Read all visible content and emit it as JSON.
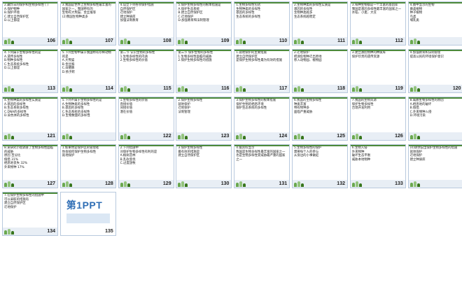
{
  "slides": [
    {
      "number": "106",
      "text": "2.藏羚羊的保护和生物多样性 (  )\nA.保护物种\nB.保护环境\nC.建立自然保护区\nD.以上都是"
    },
    {
      "number": "107",
      "text": "3.我国是世界上生物多样性最丰富的国家之一，我国特有的\n生物有大熊猫、金丝猴等\n(2)我国生物种类多"
    },
    {
      "number": "108",
      "text": "4.设立下列各项保护措施\n自然保护区\n迁地保护\n建立种质库\n加强法制教育"
    },
    {
      "number": "109",
      "text": "5.保护生物多样性的根本措施是\nA.保护生态系统\nB.建立自然保护区\nC.迁地保护\nD.加强教育和法制管理"
    },
    {
      "number": "110",
      "text": "1.生物多样性包括\n生物种类的多样性\n基因的多样性\n生态系统的多样性"
    },
    {
      "number": "111",
      "text": "2.生物种类的多样性实质是\n基因的多样性\n生物种类越多\n生态系统越稳定"
    },
    {
      "number": "112",
      "text": "3.每种生物都是一个丰富的基因库\n我国是基因多样性最丰富的国家之一\n水稻、小麦、大豆"
    },
    {
      "number": "",
      "text": "4.图中显示的生物\n蕨类植物\n种子植物\n鸟类\n哺乳类"
    },
    {
      "number": "113",
      "text": "4.下列属于生物多样性的是\nA.遗传多样性\nB.物种多样性\nC.生态系统多样性\nD.以上都是"
    },
    {
      "number": "114",
      "text": "5.下列生物中属于我国特有珍稀动物的是\nA.大熊猫\nB.金丝猴\nC.白鳍豚\nD.扬子鳄"
    },
    {
      "number": "115",
      "text": "第二节 认识生物的多样性\n1.生物多样性的内涵\n2.生物多样性的价值"
    },
    {
      "number": "116",
      "text": "第三节 保护生物的多样性\n1.生物多样性面临的威胁\n2.保护生物多样性的措施"
    },
    {
      "number": "117",
      "text": "1.就地保护的主要措施\n建立自然保护区\n是保护生物多样性最为有效的措施"
    },
    {
      "number": "118",
      "text": "2.迁地保护\n把濒危物种迁出原地\n移入动物园、植物园"
    },
    {
      "number": "119",
      "text": "3.建立濒危物种的种质库\n保护珍贵的遗传资源"
    },
    {
      "number": "120",
      "text": "4.加强教育和法制管理\n提高公民的环境保护意识"
    },
    {
      "number": "121",
      "text": "4.生物种类的多样性实质是\nA.基因的多样性\nB.生态系统多样性\nC.DNA的多样性\nD.染色体的多样性"
    },
    {
      "number": "",
      "text": "5.下列不属于生物多样性的是\nA.生物种类的多样性\nB.基因的多样性\nC.生态系统的多样性\nD.生物数量的多样性"
    },
    {
      "number": "122",
      "text": "1.生物多样性的价值\n直接价值\n间接价值\n潜在价值"
    },
    {
      "number": "123",
      "text": "2.保护生物多样性\n就地保护\n迁地保护\n法制管理"
    },
    {
      "number": "124",
      "text": "3.保护生物多样性的根本措施\n保护生物的栖息环境\n保护生态系统的多样性"
    },
    {
      "number": "125",
      "text": "6.我国的生物多样性\n种类丰富\n特有物种多\n面临严重威胁"
    },
    {
      "number": "126",
      "text": "7.我国的生物资源\n保护生物多样性\n合理开发利用"
    },
    {
      "number": "",
      "text": "8.威胁生物多样性的原因\nA.栖息地的破坏\nB.偷猎\nC.外来物种入侵\nD.环境污染"
    },
    {
      "number": "127",
      "text": "8.某研究小组调查了生物多样性面临的威胁\n原因 百分比\n偷猎 31%\n栖息地丧失 32%\n外来物种 17%"
    },
    {
      "number": "128",
      "text": "1.如果你是保护区的管理者\n你会如何保护生物多样性\n就地保护"
    },
    {
      "number": "129",
      "text": "2.下列措施中\n对保护生物多样性有利的是\nA.植树造林\nB.乱砍滥伐\nC.过度放牧"
    },
    {
      "number": "130",
      "text": "3.保护生物多样性\n最有效的措施是\n建立自然保护区"
    },
    {
      "number": "131",
      "text": "4.据资料显示\n我国是生物多样性最丰富的国家之一\n也是生物多样性受威胁最严重的国家之一"
    },
    {
      "number": "132",
      "text": "5.生物多样性的保护\n需要每个人的参与\n从身边的小事做起"
    },
    {
      "number": "133",
      "text": "6.生物入侵\n外来物种\n破坏生态平衡\n威胁本地物种"
    },
    {
      "number": "",
      "text": "(4)请你说出保护生物多样性的措施\n就地保护\n迁地保护\n建立种质库"
    },
    {
      "number": "134",
      "text": "7.在保护生物多样性的措施中\n可以采取的措施有\n建立自然保护区\n迁地保护"
    },
    {
      "number": "135",
      "text": "第1PPT"
    }
  ]
}
